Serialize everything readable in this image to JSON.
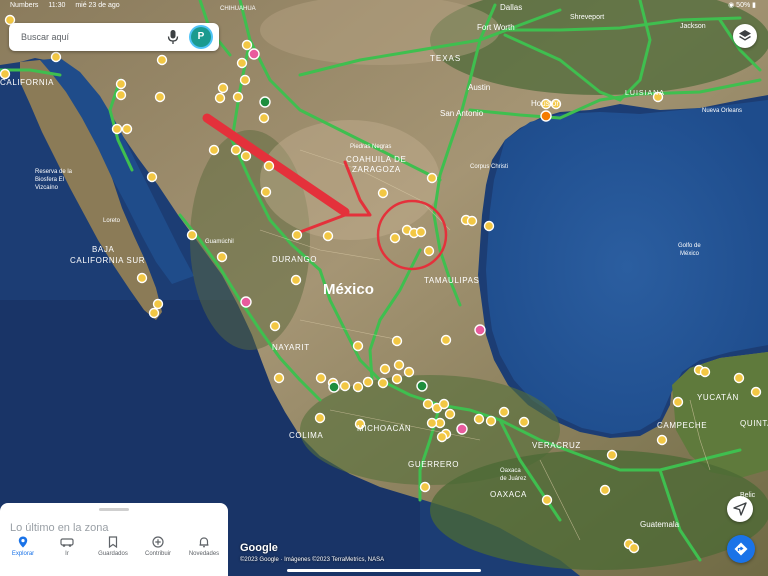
{
  "status_bar": {
    "carrier": "Numbers",
    "time": "11:30",
    "date": "mié 23 de ago",
    "battery": "50%"
  },
  "search": {
    "placeholder": "Buscar aquí",
    "avatar_letter": "P"
  },
  "map": {
    "labels": {
      "dallas": "Dallas",
      "fort_worth": "Fort Worth",
      "shreveport": "Shreveport",
      "jackson": "Jackson",
      "texas": "TEXAS",
      "austin": "Austin",
      "louisiana": "LUISIANA",
      "houston": "Houston",
      "san_antonio": "San Antonio",
      "nuevo_orleans": "Nueva Orleans",
      "corpus_christi": "Corpus Christi",
      "piedras_negras": "Piedras Negras",
      "coahuila": "COAHUILA DE",
      "zaragoza": "ZARAGOZA",
      "chihuahua": "CHIHUAHUA",
      "california": "CALIFORNIA",
      "reserva_1": "Reserva de la",
      "reserva_2": "Biosfera El",
      "reserva_3": "Vizcaíno",
      "loreto": "Loreto",
      "baja_1": "BAJA",
      "baja_2": "CALIFORNIA SUR",
      "guamuchil": "Guamúchil",
      "durango": "DURANGO",
      "mexico": "México",
      "tamaulipas": "TAMAULIPAS",
      "golfo_1": "Golfo de",
      "golfo_2": "México",
      "nayarit": "NAYARIT",
      "yucatan": "YUCATÁN",
      "quintana": "QUINTA",
      "campeche": "CAMPECHE",
      "colima": "COLIMA",
      "michoacan": "MICHOACÁN",
      "veracruz": "VERACRUZ",
      "guerrero": "GUERRERO",
      "oaxaca": "OAXACA",
      "oaxaca_city_1": "Oaxaca",
      "oaxaca_city_2": "de Juárez",
      "guatemala": "Guatemala",
      "belice": "Belic"
    },
    "road_color": "#3fbf4f",
    "marker_color": "#f2c744",
    "annotation_color": "#e4313b"
  },
  "controls": {
    "layers": "layers-icon",
    "compass": "navigation-arrow-icon",
    "directions": "directions-icon"
  },
  "bottom_panel": {
    "latest": "Lo último en la zona",
    "tabs": [
      {
        "label": "Explorar",
        "icon": "pin-icon",
        "active": true
      },
      {
        "label": "Ir",
        "icon": "car-icon",
        "active": false
      },
      {
        "label": "Guardados",
        "icon": "bookmark-icon",
        "active": false
      },
      {
        "label": "Contribuir",
        "icon": "plus-circle-icon",
        "active": false
      },
      {
        "label": "Novedades",
        "icon": "bell-icon",
        "active": false
      }
    ]
  },
  "footer": {
    "logo": "Google",
    "attribution": "©2023 Google · Imágenes ©2023 TerraMetrics, NASA"
  }
}
